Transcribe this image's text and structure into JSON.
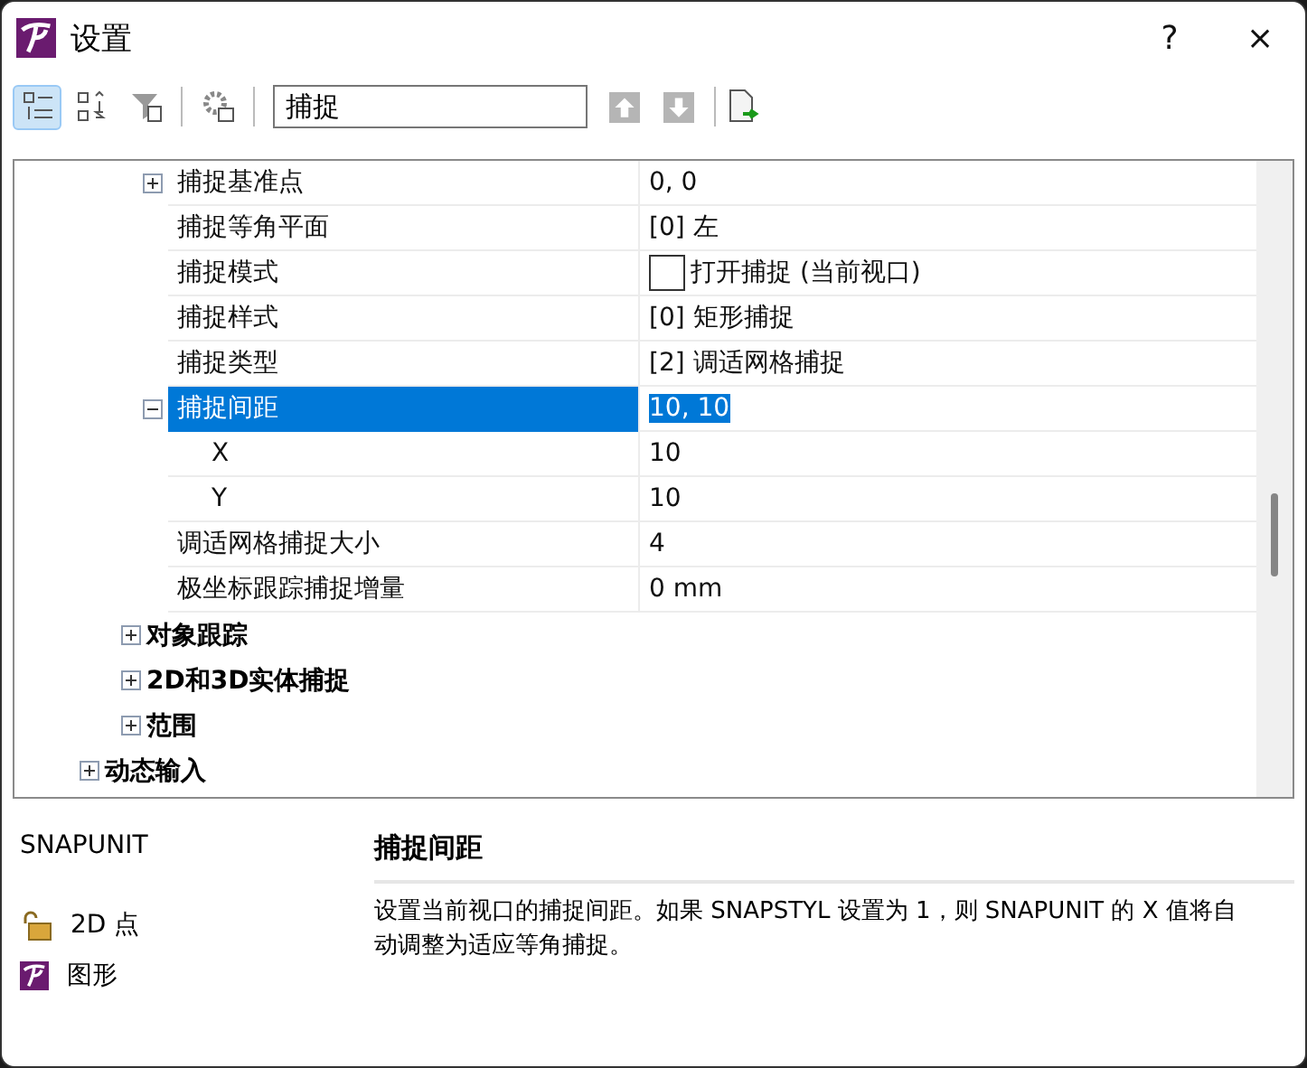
{
  "window": {
    "title": "设置",
    "help": "?",
    "close": "×"
  },
  "toolbar": {
    "buttons": [
      {
        "kind": "categorized",
        "selected": true
      },
      {
        "kind": "alphabetic",
        "selected": false
      },
      {
        "kind": "filter",
        "selected": false
      },
      {
        "kind": "settings",
        "selected": false
      }
    ],
    "search": {
      "value": "捕捉"
    },
    "nav": [
      {
        "kind": "up",
        "disabled": true
      },
      {
        "kind": "down",
        "disabled": true
      }
    ],
    "export": {
      "kind": "export"
    }
  },
  "tree": [
    {
      "children": [
        {
          "children": [
            {
              "kind": "property",
              "label": "捕捉基准点",
              "value": "0, 0",
              "expanded": false
            },
            {
              "kind": "property",
              "label": "捕捉等角平面",
              "value": "[0] 左"
            },
            {
              "kind": "checkbox",
              "label": "捕捉模式",
              "value": "打开捕捉 (当前视口)",
              "checked": false
            },
            {
              "kind": "property",
              "label": "捕捉样式",
              "value": "[0] 矩形捕捉"
            },
            {
              "kind": "property",
              "label": "捕捉类型",
              "value": "[2] 调适网格捕捉"
            },
            {
              "kind": "property",
              "label": "捕捉间距",
              "value": "10, 10",
              "expanded": true,
              "selected": true,
              "children": [
                {
                  "kind": "property",
                  "label": "X",
                  "value": "10"
                },
                {
                  "kind": "property",
                  "label": "Y",
                  "value": "10"
                }
              ]
            },
            {
              "kind": "property",
              "label": "调适网格捕捉大小",
              "value": "4"
            },
            {
              "kind": "property",
              "label": "极坐标跟踪捕捉增量",
              "value": "0 mm"
            }
          ]
        },
        {
          "kind": "group",
          "label": "对象跟踪",
          "expanded": false
        },
        {
          "kind": "group",
          "label": "2D和3D实体捕捉",
          "expanded": false
        },
        {
          "kind": "group",
          "label": "范围",
          "expanded": false
        }
      ]
    },
    {
      "kind": "group",
      "label": "动态输入",
      "expanded": false
    }
  ],
  "info": {
    "variable": "SNAPUNIT",
    "attributes": [
      {
        "kind": "lock",
        "text": "2D 点"
      },
      {
        "kind": "app",
        "text": "图形"
      }
    ],
    "title": "捕捉间距",
    "description": "设置当前视口的捕捉间距。如果 SNAPSTYL 设置为 1，则 SNAPUNIT 的 X 值将自动调整为适应等角捕捉。"
  }
}
